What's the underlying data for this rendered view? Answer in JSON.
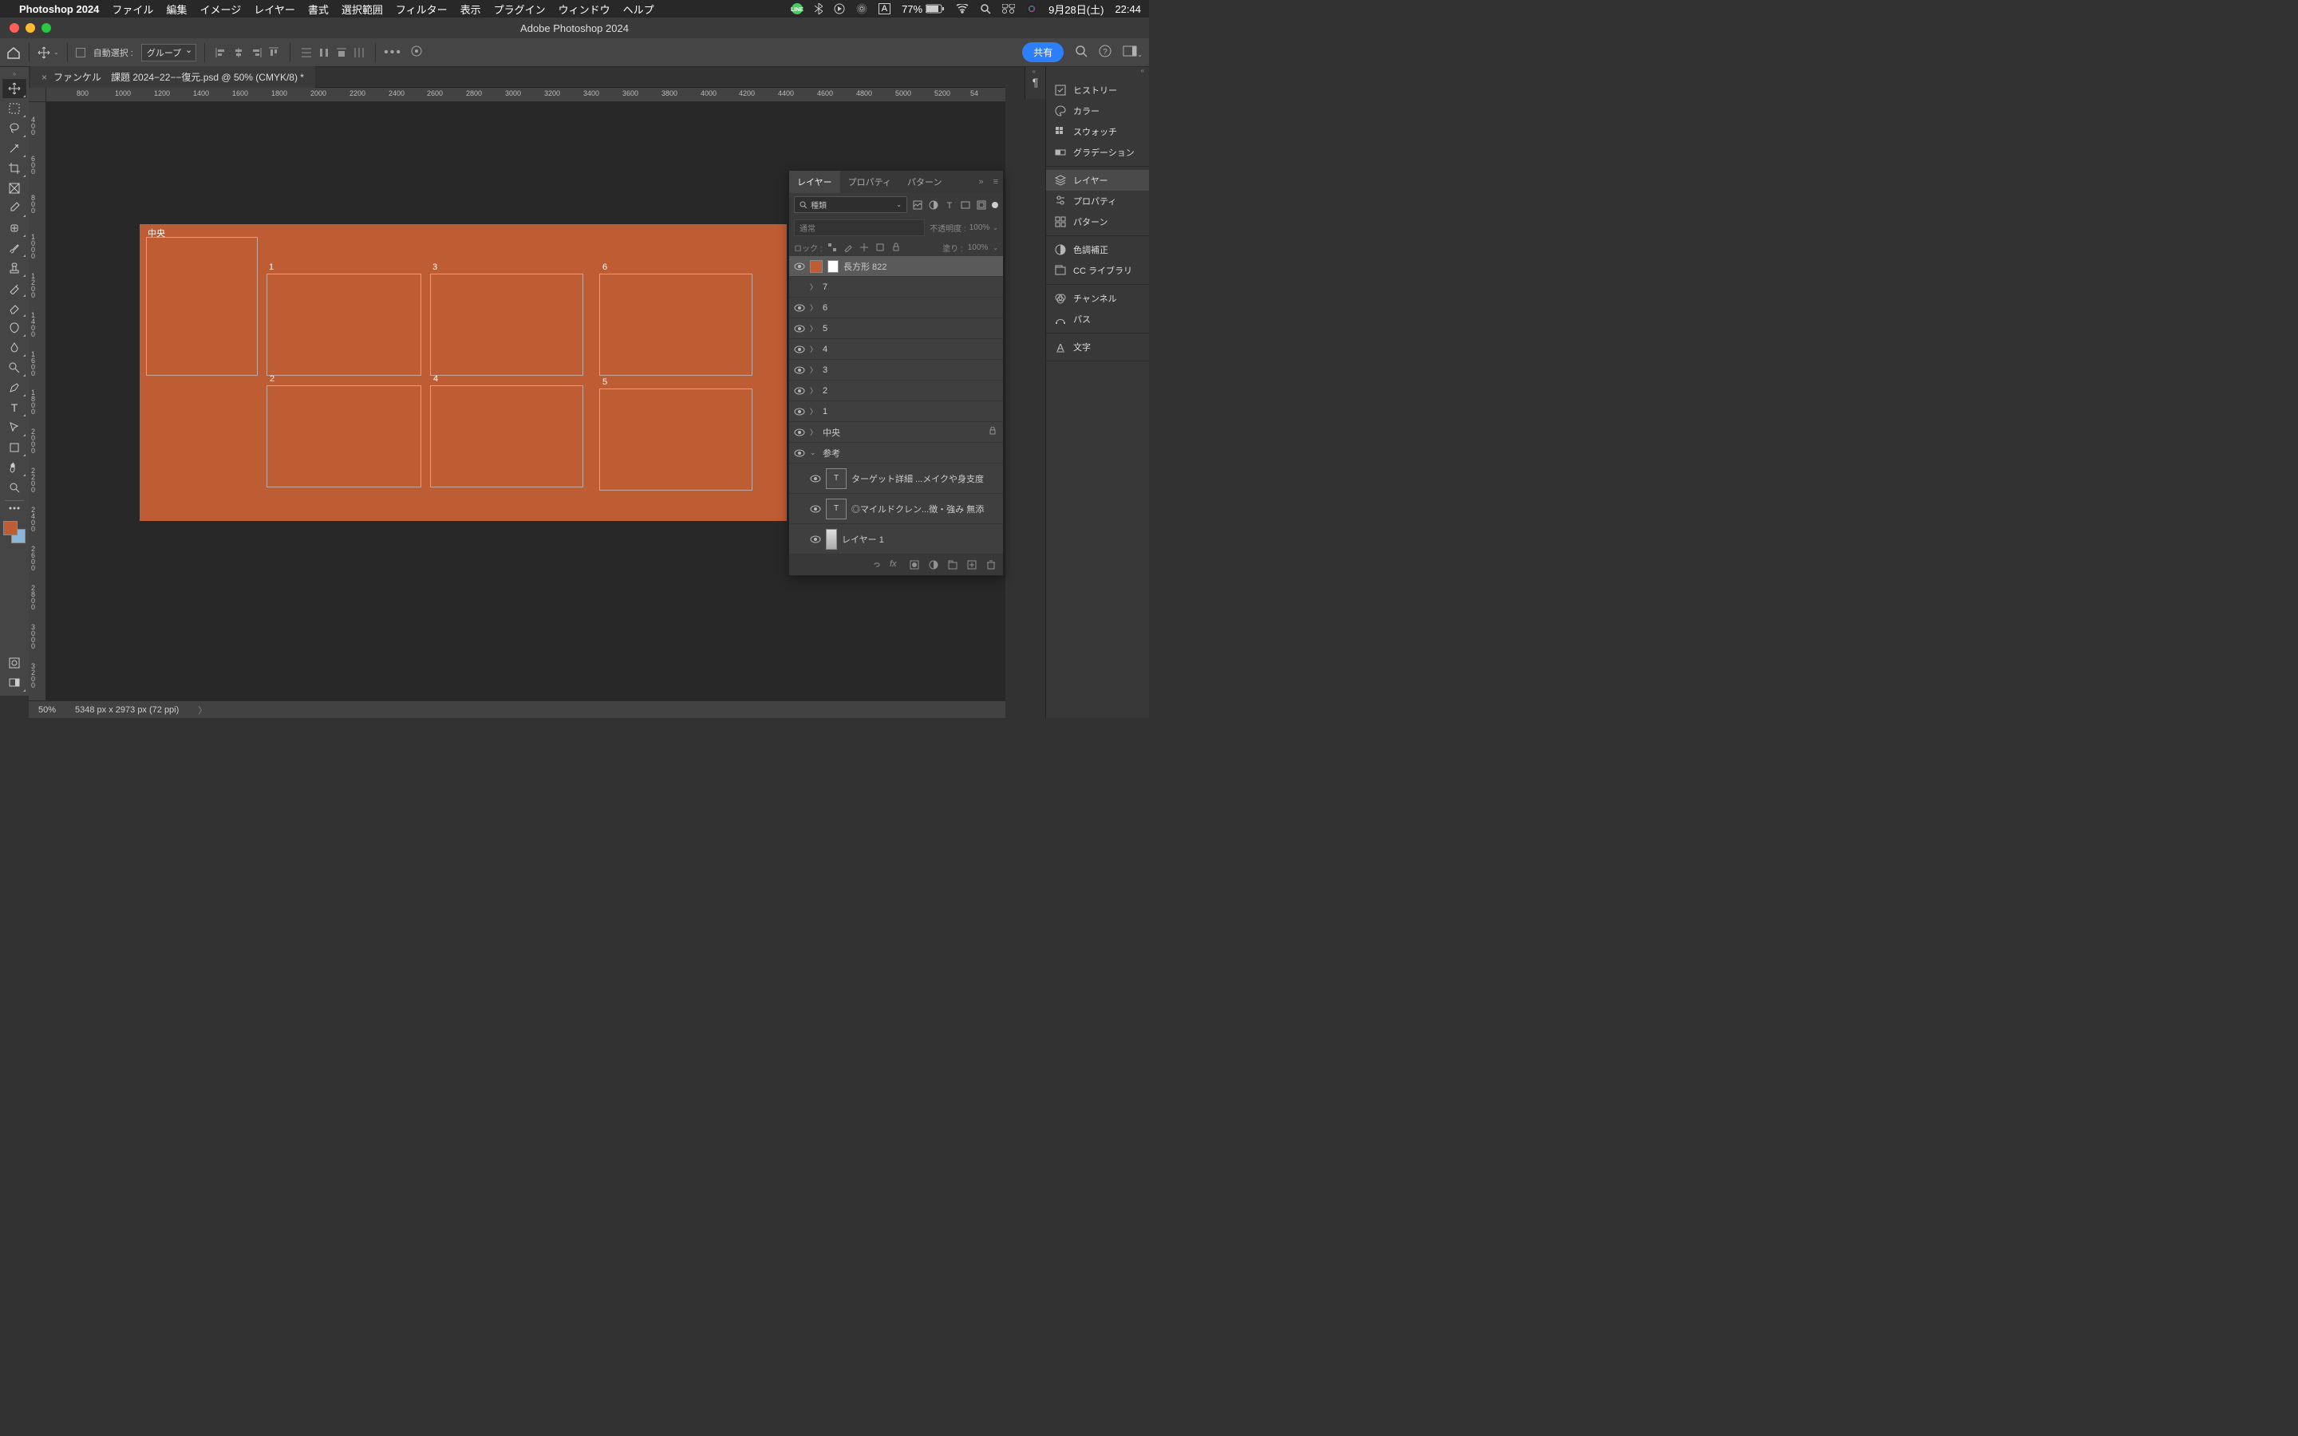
{
  "menubar": {
    "appname": "Photoshop 2024",
    "items": [
      "ファイル",
      "編集",
      "イメージ",
      "レイヤー",
      "書式",
      "選択範囲",
      "フィルター",
      "表示",
      "プラグイン",
      "ウィンドウ",
      "ヘルプ"
    ],
    "battery": "77%",
    "date": "9月28日(土)",
    "time": "22:44",
    "input_mode": "A"
  },
  "window": {
    "title": "Adobe Photoshop 2024"
  },
  "options": {
    "auto_select_label": "自動選択 :",
    "group_dropdown": "グループ",
    "share": "共有"
  },
  "document": {
    "tab": "ファンケル　課題 2024−22−−復元.psd @ 50% (CMYK/8) *",
    "zoom": "50%",
    "dims": "5348 px x 2973 px (72 ppi)"
  },
  "rulers": {
    "h": [
      "800",
      "1000",
      "1200",
      "1400",
      "1600",
      "1800",
      "2000",
      "2200",
      "2400",
      "2600",
      "2800",
      "3000",
      "3200",
      "3400",
      "3600",
      "3800",
      "4000",
      "4200",
      "4400",
      "4600",
      "4800",
      "5000",
      "5200",
      "54"
    ],
    "v": [
      "400",
      "600",
      "800",
      "1000",
      "1200",
      "1400",
      "1600",
      "1800",
      "2000",
      "2200",
      "2400",
      "2600",
      "2800",
      "3000",
      "3200"
    ]
  },
  "canvas": {
    "center_label": "中央",
    "labels": {
      "1": "1",
      "2": "2",
      "3": "3",
      "4": "4",
      "5": "5",
      "6": "6"
    }
  },
  "right_panels": {
    "group1": [
      "ヒストリー",
      "カラー",
      "スウォッチ",
      "グラデーション"
    ],
    "group2": [
      "レイヤー",
      "プロパティ",
      "パターン"
    ],
    "group3": [
      "色調補正",
      "CC ライブラリ"
    ],
    "group4": [
      "チャンネル",
      "パス"
    ],
    "group5": [
      "文字"
    ]
  },
  "layers_panel": {
    "tabs": [
      "レイヤー",
      "プロパティ",
      "パターン"
    ],
    "search_label": "種類",
    "blend_mode": "通常",
    "opacity_label": "不透明度 :",
    "opacity_value": "100%",
    "lock_label": "ロック :",
    "fill_label": "塗り :",
    "fill_value": "100%",
    "layers": [
      {
        "name": "長方形 822",
        "selected": true,
        "thumb": "shape"
      },
      {
        "name": "7",
        "group": true,
        "hidden": true
      },
      {
        "name": "6",
        "group": true
      },
      {
        "name": "5",
        "group": true
      },
      {
        "name": "4",
        "group": true
      },
      {
        "name": "3",
        "group": true
      },
      {
        "name": "2",
        "group": true
      },
      {
        "name": "1",
        "group": true
      },
      {
        "name": "中央",
        "group": true,
        "locked": true
      },
      {
        "name": "参考",
        "group": true,
        "open": true
      },
      {
        "name": "ターゲット詳細 ...メイクや身支度",
        "child": true,
        "type": "T"
      },
      {
        "name": "◎マイルドクレン...徴・強み 無添",
        "child": true,
        "type": "T"
      },
      {
        "name": "レイヤー 1",
        "child": true,
        "type": "img"
      }
    ]
  }
}
